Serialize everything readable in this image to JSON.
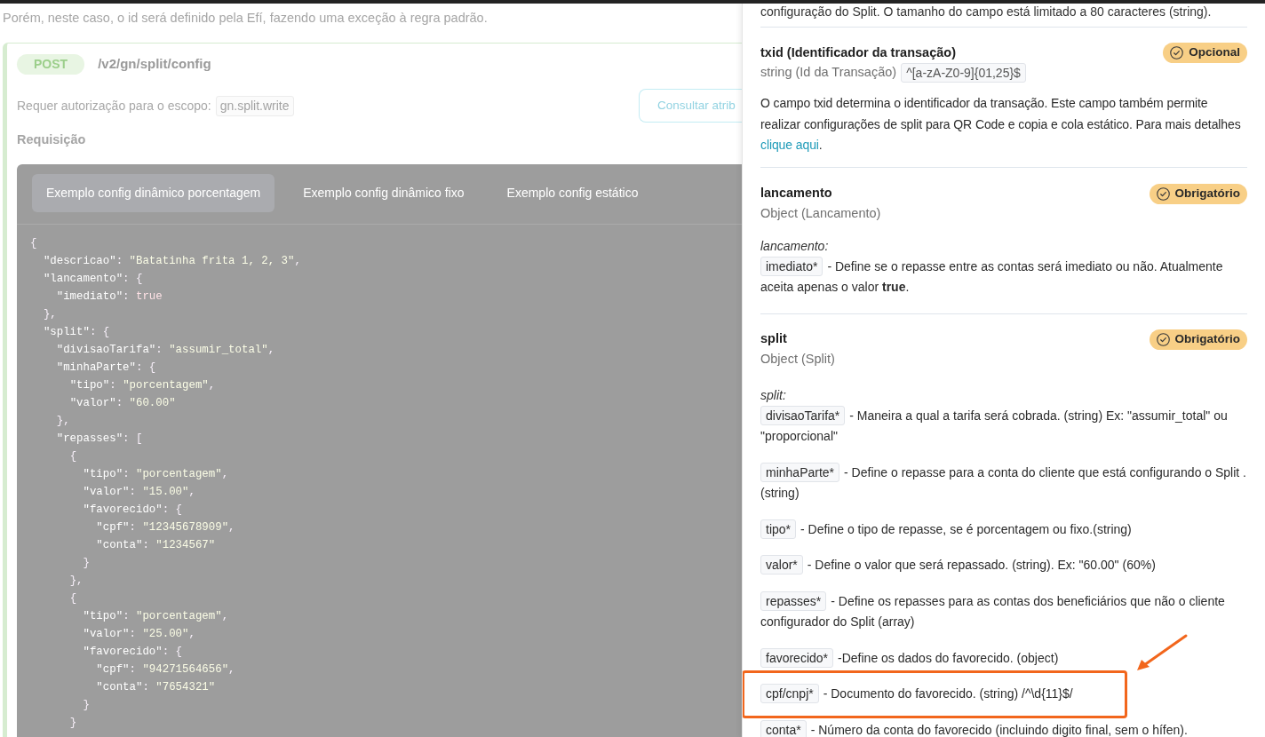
{
  "page": {
    "note": "Porém, neste caso, o id será definido pela Efí, fazendo uma exceção à regra padrão.",
    "endpoint": {
      "method": "POST",
      "path": "/v2/gn/split/config",
      "scope_label": "Requer autorização para o escopo:",
      "scope": "gn.split.write",
      "button": "Consultar atrib",
      "request_label": "Requisição",
      "tabs": [
        {
          "label": "Exemplo config dinâmico porcentagem",
          "selected": true
        },
        {
          "label": "Exemplo config dinâmico fixo",
          "selected": false
        },
        {
          "label": "Exemplo config estático",
          "selected": false
        }
      ],
      "code_lines": [
        "{",
        "  \"descricao\": \"Batatinha frita 1, 2, 3\",",
        "  \"lancamento\": {",
        "    \"imediato\": true",
        "  },",
        "  \"split\": {",
        "    \"divisaoTarifa\": \"assumir_total\",",
        "    \"minhaParte\": {",
        "      \"tipo\": \"porcentagem\",",
        "      \"valor\": \"60.00\"",
        "    },",
        "    \"repasses\": [",
        "      {",
        "        \"tipo\": \"porcentagem\",",
        "        \"valor\": \"15.00\",",
        "        \"favorecido\": {",
        "          \"cpf\": \"12345678909\",",
        "          \"conta\": \"1234567\"",
        "        }",
        "      },",
        "      {",
        "        \"tipo\": \"porcentagem\",",
        "        \"valor\": \"25.00\",",
        "        \"favorecido\": {",
        "          \"cpf\": \"94271564656\",",
        "          \"conta\": \"7654321\"",
        "        }",
        "      }"
      ]
    }
  },
  "drawer": {
    "intro": "configuração do Split. O tamanho do campo está limitado a 80 caracteres (string).",
    "fields": [
      {
        "name": "txid (Identificador da transação)",
        "badge": "Opcional",
        "type": "string (Id da Transação)",
        "pattern": "^[a-zA-Z0-9]{01,25}$",
        "description": "O campo txid determina o identificador da transação. Este campo também permite realizar configurações de split para QR Code e copia e cola estático. Para mais detalhes",
        "link": "clique aqui",
        "description_end": "."
      },
      {
        "name": "lancamento",
        "badge": "Obrigatório",
        "type": "Object (Lancamento)",
        "object_label": "lancamento:",
        "items": [
          {
            "code": "imediato*",
            "text": "- Define se o repasse entre as contas será imediato ou não. Atualmente aceita apenas o valor **true**.",
            "highlighted": false
          }
        ]
      },
      {
        "name": "split",
        "badge": "Obrigatório",
        "type": "Object (Split)",
        "object_label": "split:",
        "items": [
          {
            "code": "divisaoTarifa*",
            "text": "- Maneira a qual a tarifa será cobrada. (string) Ex: \"assumir_total\" ou \"proporcional\"",
            "highlighted": false
          },
          {
            "code": "minhaParte*",
            "text": "- Define o repasse para a conta do cliente que está configurando o Split . (string)",
            "highlighted": false
          },
          {
            "code": "tipo*",
            "text": "- Define o tipo de repasse, se é porcentagem ou fixo.(string)",
            "highlighted": false
          },
          {
            "code": "valor*",
            "text": "- Define o valor que será repassado. (string). Ex: \"60.00\" (60%)",
            "highlighted": false
          },
          {
            "code": "repasses*",
            "text": "- Define os repasses para as contas dos beneficiários que não o cliente configurador do Split (array)",
            "highlighted": false
          },
          {
            "code": "favorecido*",
            "text": "-Define os dados do favorecido. (object)",
            "highlighted": false
          },
          {
            "code": "cpf/cnpj*",
            "text": "- Documento do favorecido. (string) /^\\d{11}$/",
            "highlighted": true
          },
          {
            "code": "conta*",
            "text": "- Número da conta do favorecido (incluindo digito final, sem o hífen).",
            "highlighted": false
          }
        ]
      }
    ]
  }
}
